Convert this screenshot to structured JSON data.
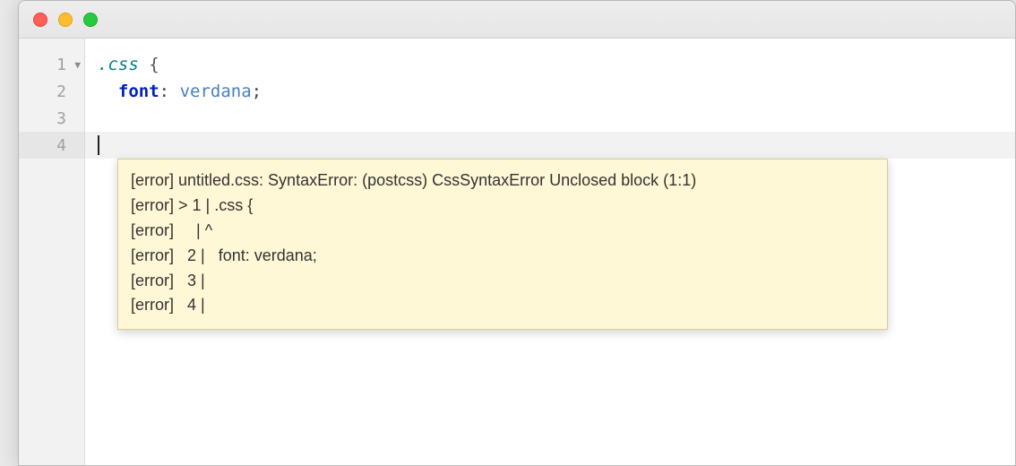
{
  "gutter": {
    "lines": [
      "1",
      "2",
      "3",
      "4"
    ],
    "foldable_line_index": 0,
    "current_line_index": 3
  },
  "code": {
    "lines": [
      {
        "tokens": [
          {
            "t": "selector",
            "v": ".css"
          },
          {
            "t": "space",
            "v": " "
          },
          {
            "t": "brace",
            "v": "{"
          }
        ]
      },
      {
        "tokens": [
          {
            "t": "indent",
            "v": "  "
          },
          {
            "t": "prop",
            "v": "font"
          },
          {
            "t": "punct",
            "v": ":"
          },
          {
            "t": "space",
            "v": " "
          },
          {
            "t": "value",
            "v": "verdana"
          },
          {
            "t": "punct",
            "v": ";"
          }
        ]
      },
      {
        "tokens": []
      },
      {
        "tokens": [],
        "cursor": true
      }
    ]
  },
  "tooltip": {
    "lines": [
      "[error] untitled.css: SyntaxError: (postcss) CssSyntaxError Unclosed block (1:1)",
      "[error] > 1 | .css {",
      "[error]     | ^",
      "[error]   2 |   font: verdana;",
      "[error]   3 |",
      "[error]   4 |"
    ]
  }
}
